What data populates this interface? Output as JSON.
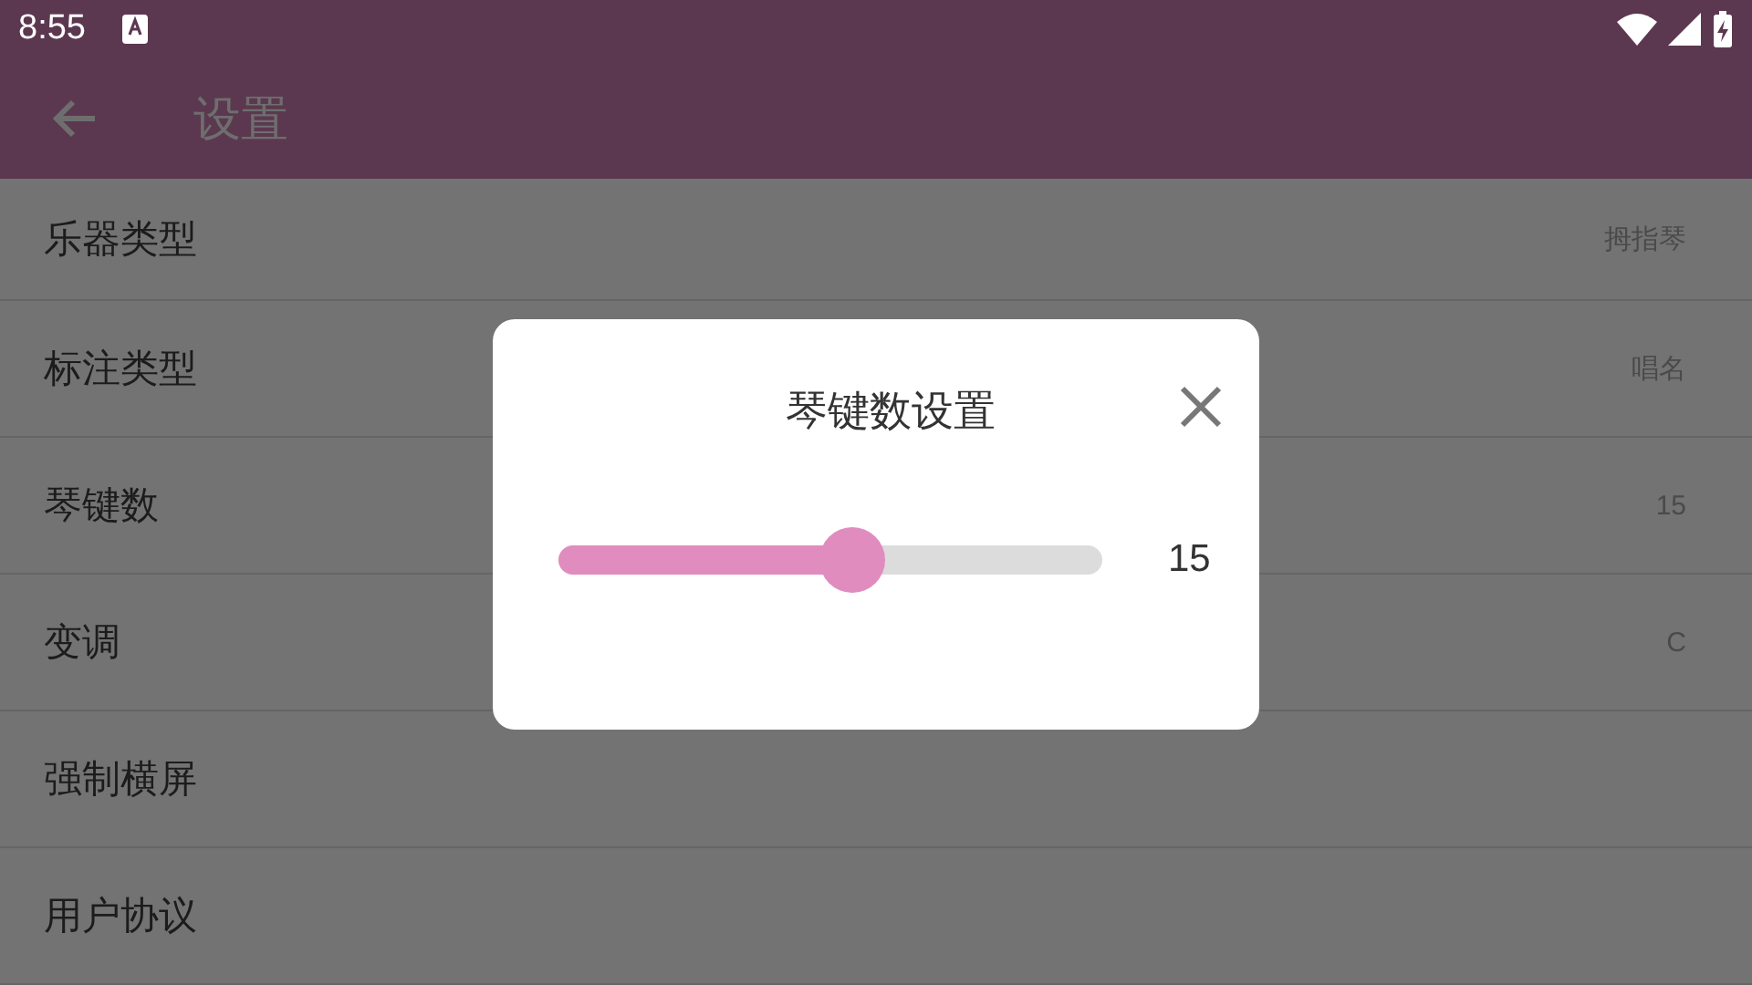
{
  "status_bar": {
    "time": "8:55"
  },
  "app_bar": {
    "title": "设置"
  },
  "settings": [
    {
      "label": "乐器类型",
      "value": "拇指琴"
    },
    {
      "label": "标注类型",
      "value": "唱名"
    },
    {
      "label": "琴键数",
      "value": "15"
    },
    {
      "label": "变调",
      "value": "C"
    },
    {
      "label": "强制横屏"
    },
    {
      "label": "用户协议"
    }
  ],
  "dialog": {
    "title": "琴键数设置",
    "slider": {
      "level": 0.54
    },
    "reading": "15"
  }
}
